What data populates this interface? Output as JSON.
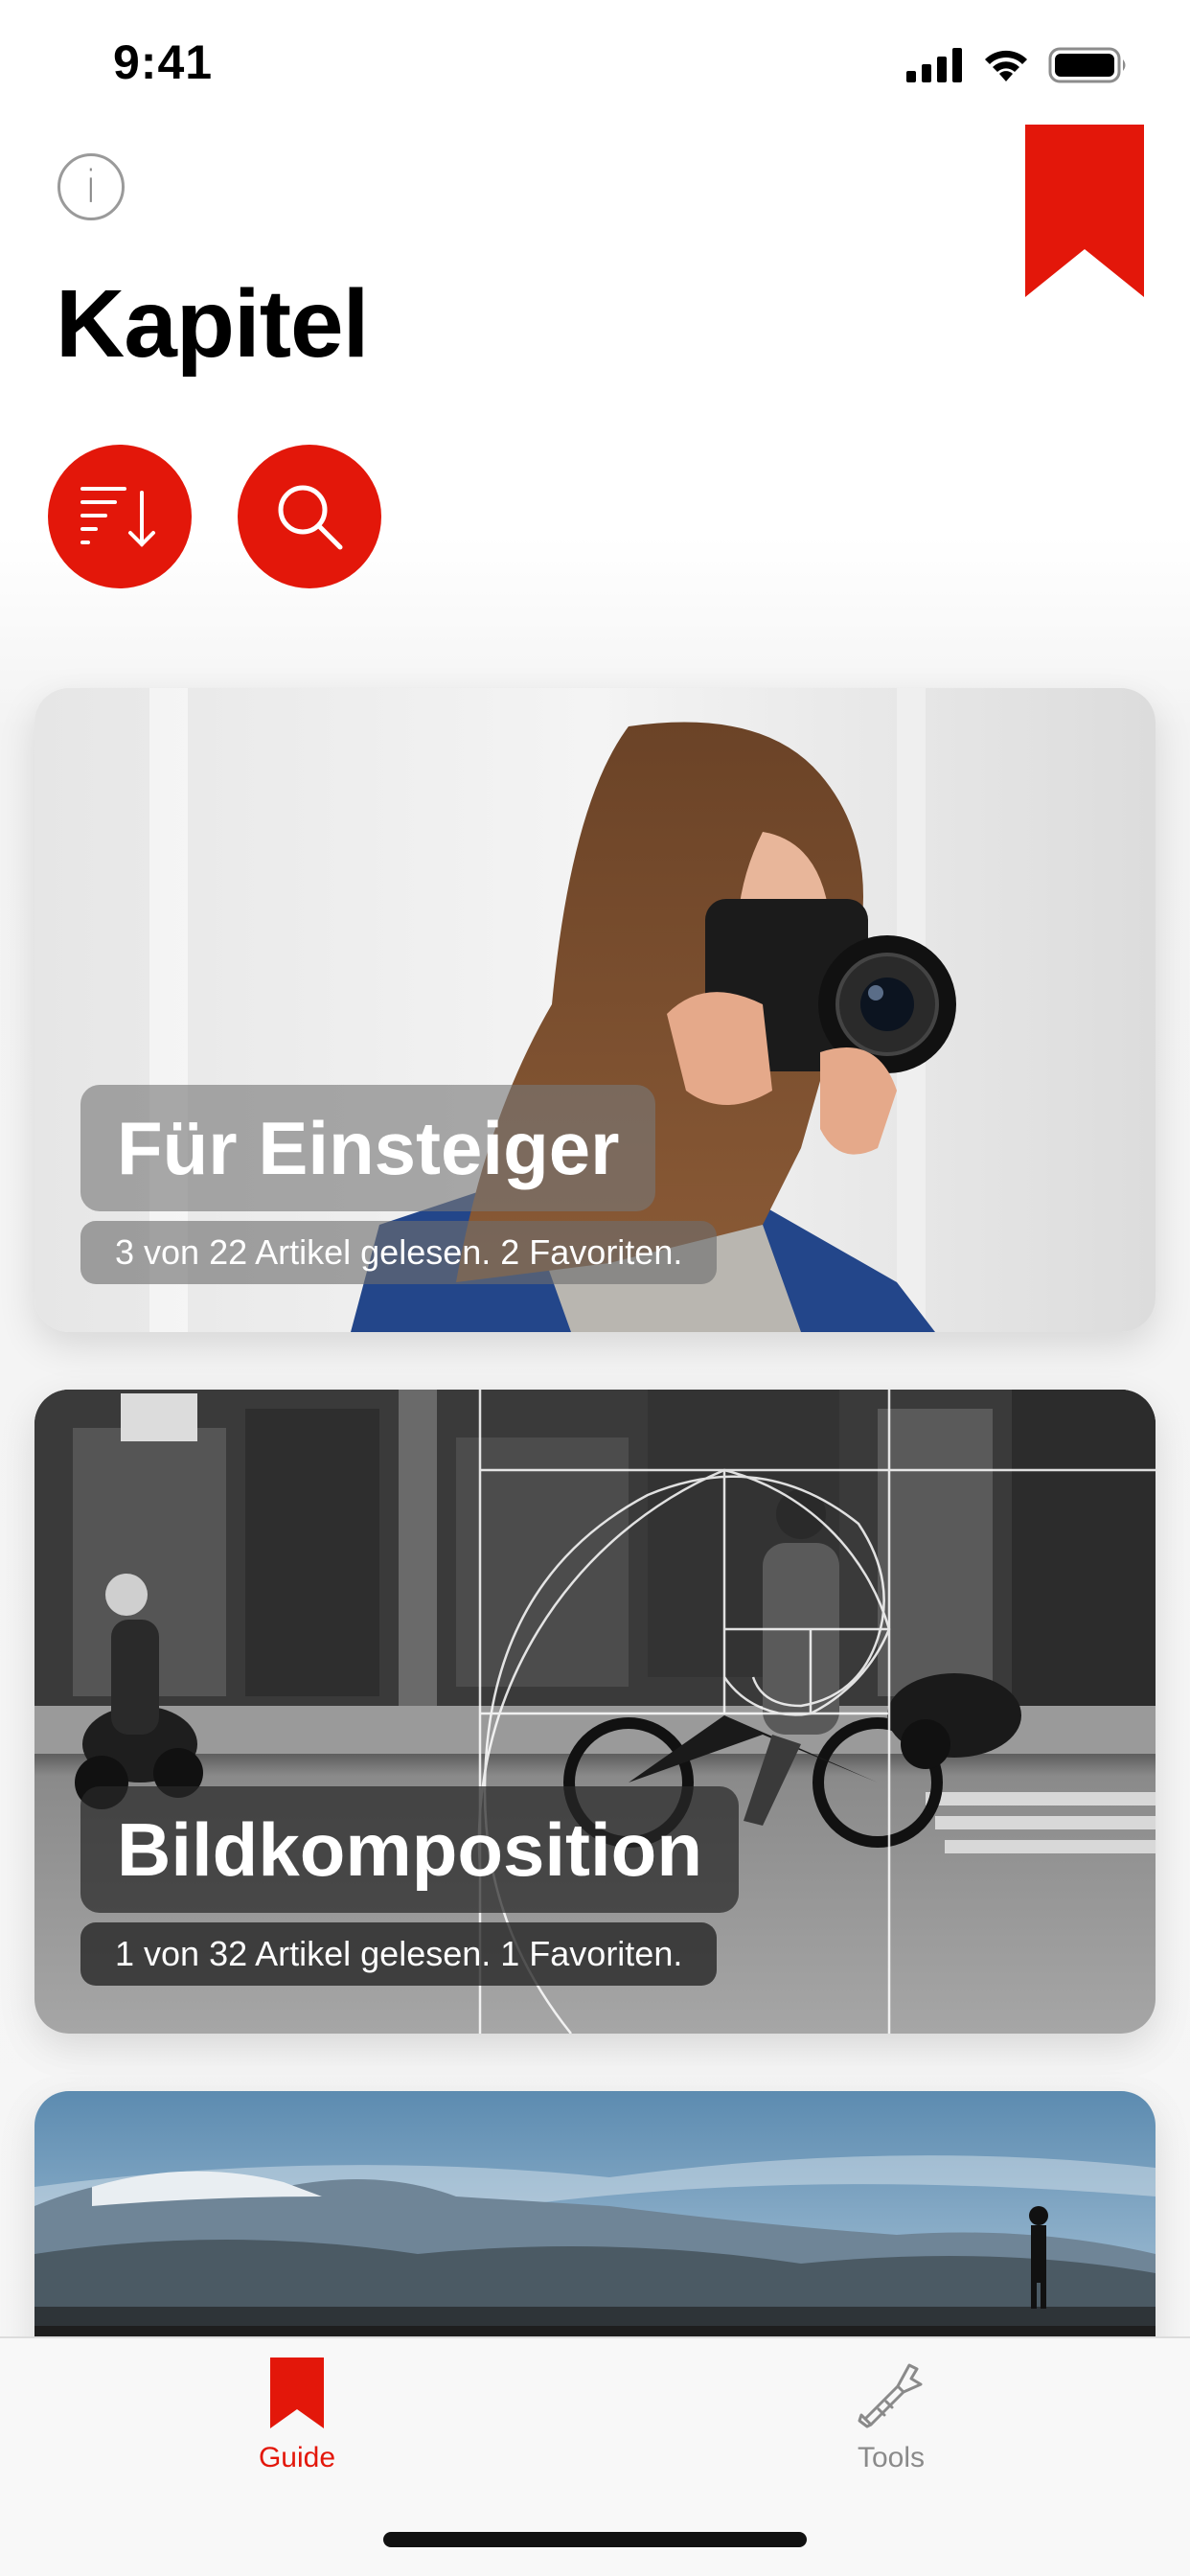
{
  "status_bar": {
    "time": "9:41",
    "icons": [
      "cellular-signal-icon",
      "wifi-icon",
      "battery-icon"
    ]
  },
  "header": {
    "info_icon": "info-icon",
    "info_glyph": "i",
    "bookmark_icon": "bookmark-ribbon-icon",
    "title": "Kapitel",
    "sort_icon": "sort-descending-icon",
    "search_icon": "search-icon"
  },
  "cards": [
    {
      "title": "Für Einsteiger",
      "subtitle": "3 von 22 Artikel gelesen. 2 Favoriten.",
      "photo": "woman-with-camera-photo"
    },
    {
      "title": "Bildkomposition",
      "subtitle": "1 von 32 Artikel gelesen. 1 Favoriten.",
      "photo": "street-scene-golden-spiral-photo"
    },
    {
      "title": "",
      "subtitle": "",
      "photo": "mountain-landscape-photo"
    }
  ],
  "tab_bar": {
    "tabs": [
      {
        "label": "Guide",
        "icon": "bookmark-icon",
        "active": true
      },
      {
        "label": "Tools",
        "icon": "tools-icon",
        "active": false
      }
    ]
  },
  "colors": {
    "accent": "#e3170a",
    "tab_inactive": "#8a8a8a",
    "background": "#ffffff"
  }
}
